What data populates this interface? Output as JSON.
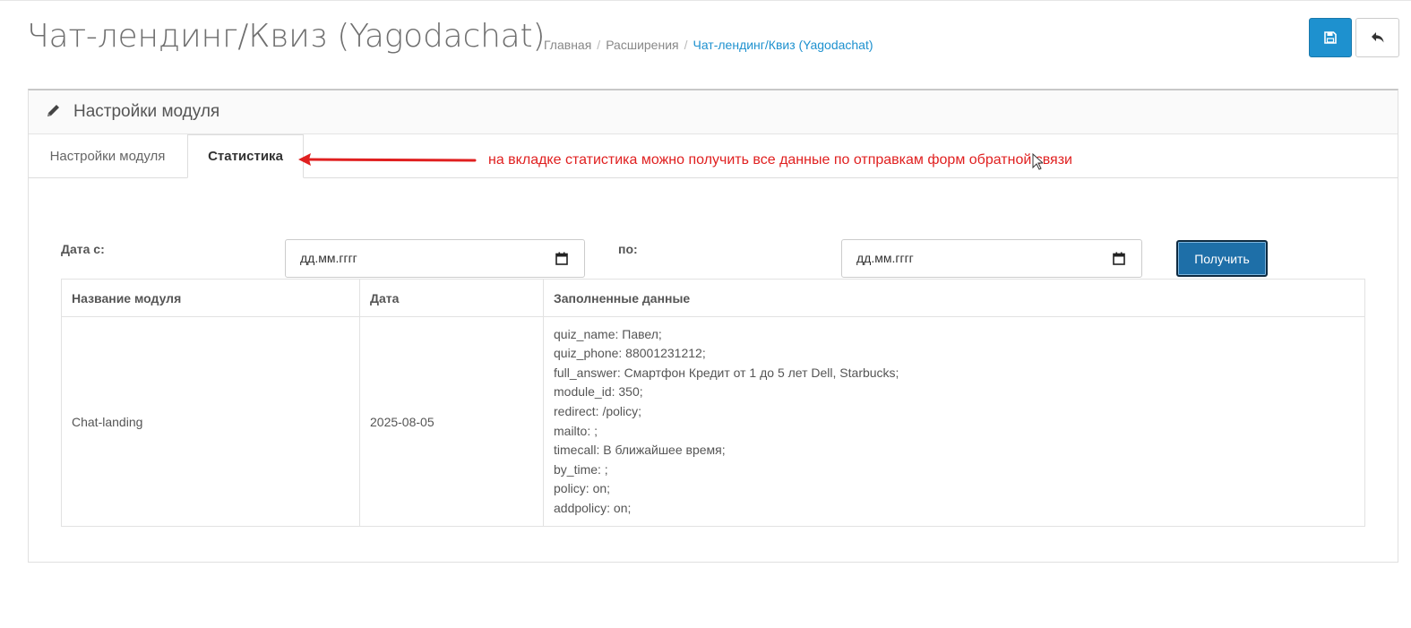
{
  "header": {
    "title": "Чат-лендинг/Квиз (Yagodachat)",
    "breadcrumb": [
      "Главная",
      "Расширения",
      "Чат-лендинг/Квиз (Yagodachat)"
    ]
  },
  "panel": {
    "title": "Настройки модуля",
    "tabs": [
      {
        "label": "Настройки модуля",
        "active": false
      },
      {
        "label": "Статистика",
        "active": true
      }
    ]
  },
  "annotation": {
    "text": "на вкладке статистика можно получить все данные по отправкам форм обратной связи",
    "color": "#e02020"
  },
  "filter": {
    "date_from_label": "Дата с:",
    "date_from_placeholder": "дд.мм.гггг",
    "date_to_label": "по:",
    "date_to_placeholder": "дд.мм.гггг",
    "submit_label": "Получить"
  },
  "table": {
    "headers": [
      "Название модуля",
      "Дата",
      "Заполненные данные"
    ],
    "rows": [
      {
        "module": "Chat-landing",
        "date": "2025-08-05",
        "data_lines": [
          "quiz_name: Павел;",
          "quiz_phone: 88001231212;",
          "full_answer: Смартфон Кредит от 1 до 5 лет Dell, Starbucks;",
          "module_id: 350;",
          "redirect: /policy;",
          "mailto: ;",
          "timecall: В ближайшее время;",
          "by_time: ;",
          "policy: on;",
          "addpolicy: on;"
        ]
      }
    ]
  },
  "colors": {
    "primary": "#1e91cf",
    "link": "#1e91cf"
  },
  "icons": {
    "save": "floppy-disk-icon",
    "back": "reply-arrow-icon",
    "panel": "pencil-icon",
    "date": "calendar-icon"
  }
}
